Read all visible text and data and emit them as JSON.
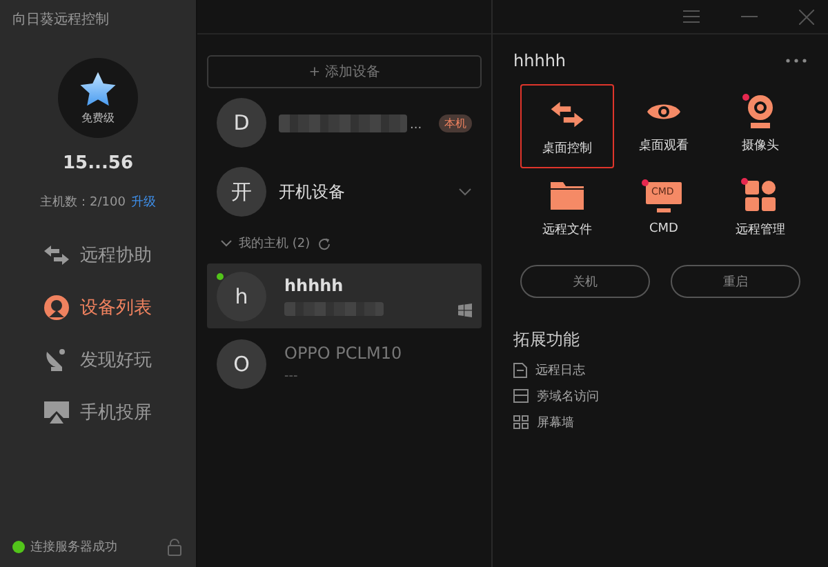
{
  "window": {
    "title": "向日葵远程控制"
  },
  "profile": {
    "tier": "免费级",
    "account": "15...56",
    "host_count_label": "主机数：2/100",
    "upgrade_link": "升级"
  },
  "nav": [
    {
      "kind": "assist",
      "label": "远程协助",
      "selected": false
    },
    {
      "kind": "devices",
      "label": "设备列表",
      "selected": true
    },
    {
      "kind": "discover",
      "label": "发现好玩",
      "selected": false
    },
    {
      "kind": "cast",
      "label": "手机投屏",
      "selected": false
    }
  ],
  "status_bar": {
    "text": "连接服务器成功",
    "connected": true
  },
  "add_device_button": "+ 添加设备",
  "local_device": {
    "avatar": "D",
    "name_suffix": "...",
    "badge": "本机"
  },
  "boot_device": {
    "avatar": "开",
    "label": "开机设备"
  },
  "group": {
    "label": "我的主机 (2)",
    "expanded": true
  },
  "hosts": [
    {
      "avatar": "h",
      "name": "hhhhh",
      "online": true,
      "selected": true,
      "kind": "windows"
    },
    {
      "avatar": "O",
      "name": "OPPO PCLM10",
      "subtitle": "---",
      "online": false,
      "selected": false
    }
  ],
  "detail": {
    "title": "hhhhh",
    "actions": [
      {
        "kind": "desktop-control",
        "label": "桌面控制",
        "selected": true,
        "dot": false
      },
      {
        "kind": "desktop-view",
        "label": "桌面观看",
        "selected": false,
        "dot": false
      },
      {
        "kind": "camera",
        "label": "摄像头",
        "selected": false,
        "dot": true
      },
      {
        "kind": "files",
        "label": "远程文件",
        "selected": false,
        "dot": false
      },
      {
        "kind": "cmd",
        "label": "CMD",
        "icon_text": "CMD",
        "selected": false,
        "dot": true
      },
      {
        "kind": "manage",
        "label": "远程管理",
        "selected": false,
        "dot": true
      }
    ],
    "buttons": [
      "关机",
      "重启"
    ],
    "extensions_title": "拓展功能",
    "extensions": [
      {
        "kind": "log",
        "label": "远程日志"
      },
      {
        "kind": "domain",
        "label": "蒡域名访问"
      },
      {
        "kind": "wall",
        "label": "屏幕墙"
      }
    ]
  }
}
